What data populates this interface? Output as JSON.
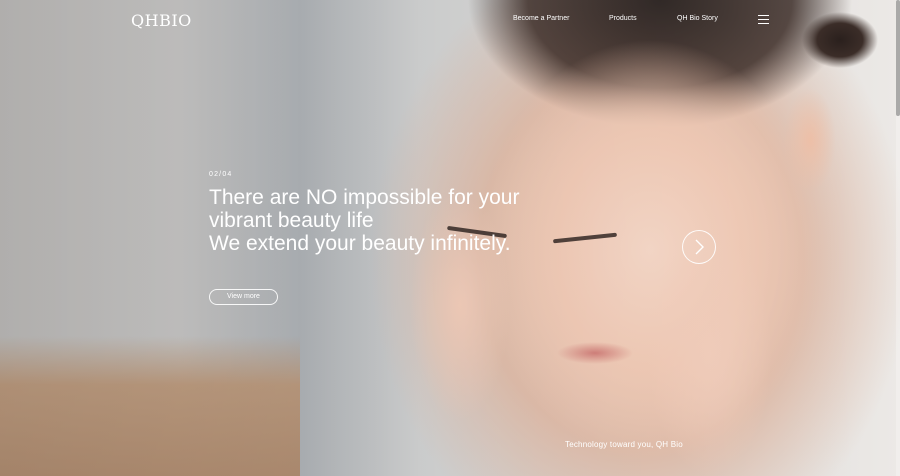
{
  "header": {
    "logo_text": "QHBIO",
    "nav": [
      {
        "label": "Become a Partner"
      },
      {
        "label": "Products"
      },
      {
        "label": "QH Bio Story"
      }
    ],
    "menu_icon": "hamburger-menu-icon"
  },
  "hero": {
    "counter": "02/04",
    "headline": [
      "There are NO impossible for your",
      "vibrant beauty life",
      "We extend your beauty infinitely."
    ],
    "cta_label": "View more",
    "next_icon": "chevron-right-icon",
    "tagline": "Technology toward you, QH Bio"
  },
  "colors": {
    "text": "#ffffff",
    "skin": "#efc9b5",
    "hair": "#2a201d",
    "background_left": "#bfbdbb"
  }
}
